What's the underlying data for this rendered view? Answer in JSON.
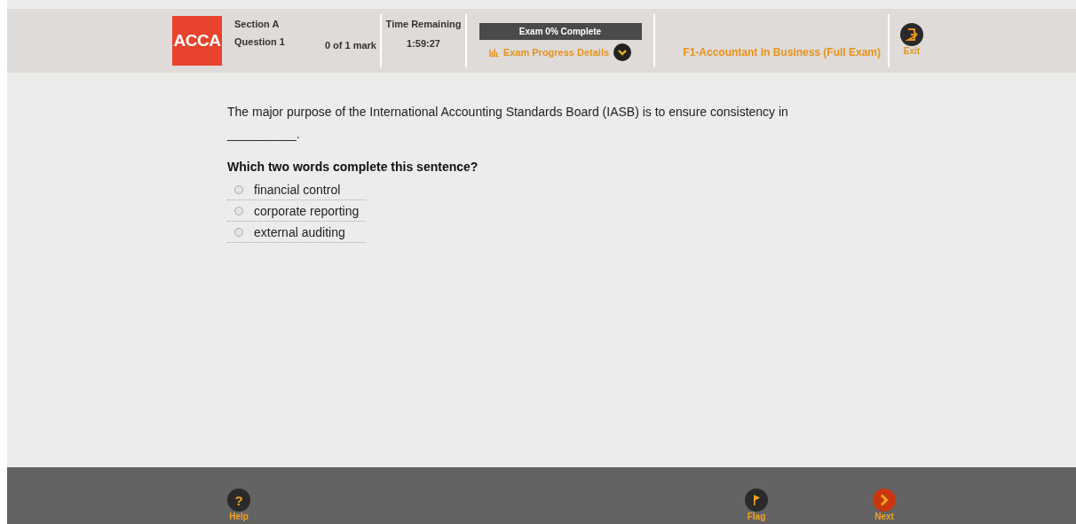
{
  "header": {
    "logo": "ACCA",
    "section": "Section A",
    "question": "Question 1",
    "marks": "0 of 1 mark",
    "time_label": "Time Remaining",
    "time": "1:59:27",
    "progress_label": "Exam 0% Complete",
    "progress_link": "Exam Progress Details",
    "exam_title": "F1-Accountant in Business (Full Exam)",
    "exit": "Exit"
  },
  "question": {
    "text": "The major purpose of the International Accounting Standards Board (IASB) is to ensure consistency in",
    "blank": "__________.",
    "prompt": "Which two words complete this sentence?"
  },
  "options": [
    {
      "label": "financial control",
      "selected": false
    },
    {
      "label": "corporate reporting",
      "selected": false
    },
    {
      "label": "external auditing",
      "selected": false
    }
  ],
  "footer": [
    {
      "kind": "help",
      "glyph": "?",
      "label": "Help"
    },
    {
      "kind": "flag",
      "label": "Flag"
    },
    {
      "kind": "next",
      "label": "Next"
    }
  ]
}
